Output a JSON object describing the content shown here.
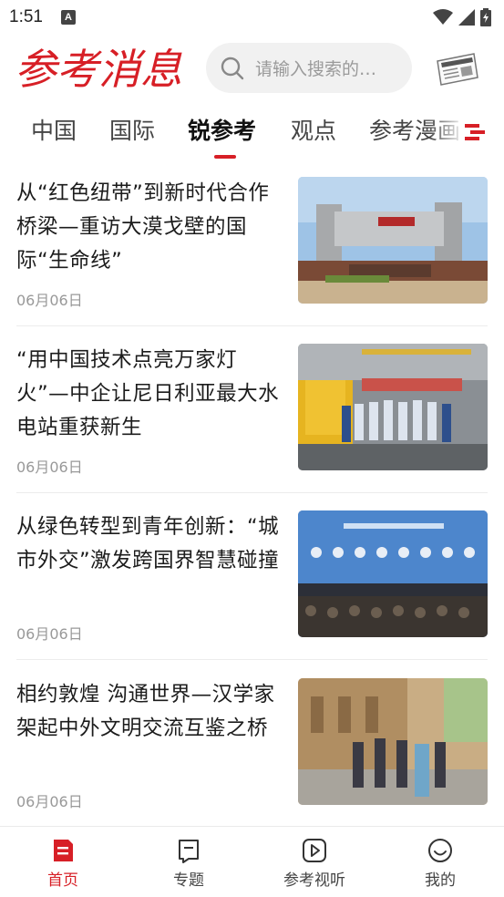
{
  "status_bar": {
    "time": "1:51",
    "notification_glyph": "A"
  },
  "header": {
    "logo_text": "参考消息",
    "search_placeholder": "请输入搜索的…"
  },
  "tabs": [
    {
      "label": "中国",
      "active": false
    },
    {
      "label": "国际",
      "active": false
    },
    {
      "label": "锐参考",
      "active": true
    },
    {
      "label": "观点",
      "active": false
    },
    {
      "label": "参考漫画",
      "active": false
    }
  ],
  "news": [
    {
      "title": "从“红色纽带”到新时代合作桥梁—重访大漠戈壁的国际“生命线”",
      "date": "06月06日"
    },
    {
      "title": "“用中国技术点亮万家灯火”—中企让尼日利亚最大水电站重获新生",
      "date": "06月06日"
    },
    {
      "title": "从绿色转型到青年创新：“城市外交”激发跨国界智慧碰撞",
      "date": "06月06日"
    },
    {
      "title": "相约敦煌 沟通世界—汉学家架起中外文明交流互鉴之桥",
      "date": "06月06日"
    }
  ],
  "bottom_nav": [
    {
      "label": "首页",
      "icon": "home-doc-icon",
      "active": true
    },
    {
      "label": "专题",
      "icon": "bookmark-icon",
      "active": false
    },
    {
      "label": "参考视听",
      "icon": "play-icon",
      "active": false
    },
    {
      "label": "我的",
      "icon": "smile-icon",
      "active": false
    }
  ],
  "colors": {
    "accent": "#d71f26",
    "text": "#1c1c1c",
    "muted": "#999999",
    "search_bg": "#f1f1f1"
  }
}
